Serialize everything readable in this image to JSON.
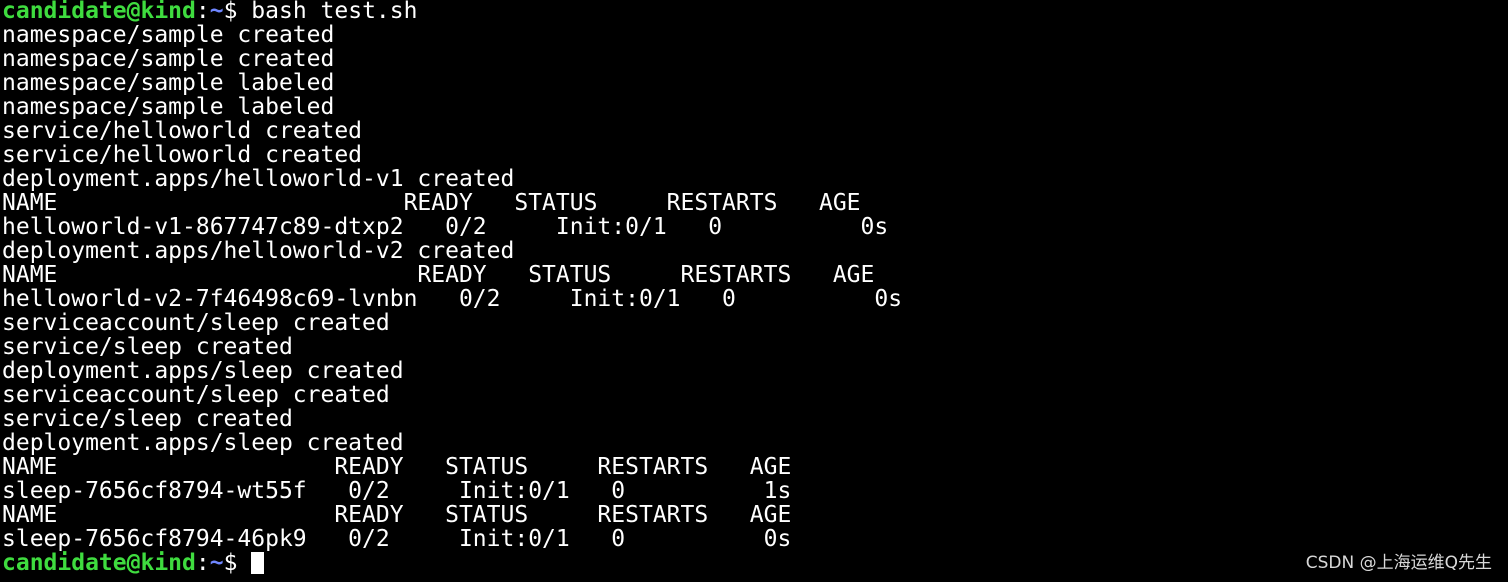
{
  "prompt": {
    "user_host": "candidate@kind",
    "separator": ":",
    "path": "~",
    "symbol": "$ "
  },
  "command": "bash test.sh",
  "output": [
    "namespace/sample created",
    "namespace/sample created",
    "namespace/sample labeled",
    "namespace/sample labeled",
    "service/helloworld created",
    "service/helloworld created",
    "deployment.apps/helloworld-v1 created",
    "NAME                         READY   STATUS     RESTARTS   AGE",
    "helloworld-v1-867747c89-dtxp2   0/2     Init:0/1   0          0s",
    "deployment.apps/helloworld-v2 created",
    "NAME                          READY   STATUS     RESTARTS   AGE",
    "helloworld-v2-7f46498c69-lvnbn   0/2     Init:0/1   0          0s",
    "serviceaccount/sleep created",
    "service/sleep created",
    "deployment.apps/sleep created",
    "serviceaccount/sleep created",
    "service/sleep created",
    "deployment.apps/sleep created",
    "NAME                    READY   STATUS     RESTARTS   AGE",
    "sleep-7656cf8794-wt55f   0/2     Init:0/1   0          1s",
    "NAME                    READY   STATUS     RESTARTS   AGE",
    "sleep-7656cf8794-46pk9   0/2     Init:0/1   0          0s"
  ],
  "watermark": "CSDN @上海运维Q先生",
  "colors": {
    "background": "#000000",
    "text": "#ffffff",
    "prompt_user": "#3fdc3f",
    "prompt_path": "#6f86ff"
  }
}
